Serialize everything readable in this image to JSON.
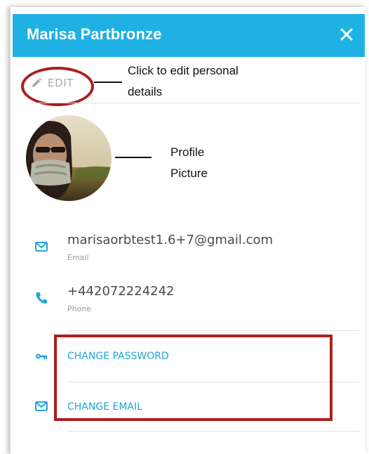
{
  "header": {
    "title": "Marisa Partbronze"
  },
  "edit": {
    "label": "EDIT"
  },
  "annotations": {
    "edit_line1": "Click to edit personal",
    "edit_line2": "details",
    "profile_line1": "Profile",
    "profile_line2": "Picture"
  },
  "contact": {
    "email_value": "marisaorbtest1.6+7@gmail.com",
    "email_caption": "Email",
    "phone_value": "+442072224242",
    "phone_caption": "Phone"
  },
  "actions": {
    "change_password": "CHANGE PASSWORD",
    "change_email": "CHANGE EMAIL"
  },
  "colors": {
    "header_bg": "#1fb1e3",
    "link": "#1fa6d9",
    "annotation_red": "#b01e1e"
  },
  "icons": {
    "close": "close-icon",
    "edit": "pencil-icon",
    "email": "mail-icon",
    "phone": "phone-icon",
    "password": "key-icon"
  }
}
